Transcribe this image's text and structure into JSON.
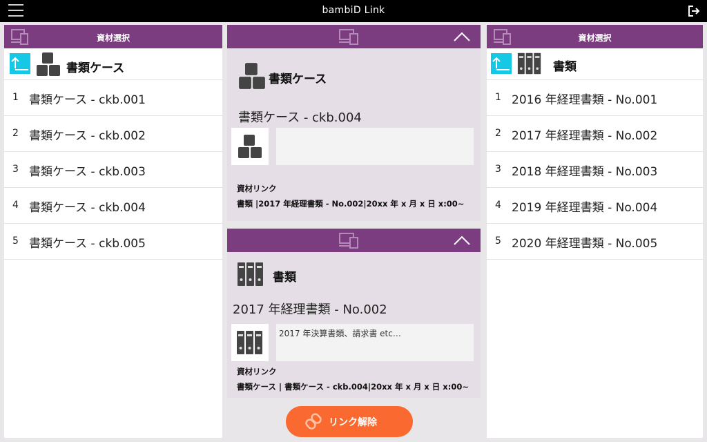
{
  "app": {
    "title": "bambiD Link"
  },
  "icons": {
    "menu": "hamburger-icon",
    "logout": "logout-icon",
    "device": "device-icon",
    "up": "up-level-icon",
    "case": "boxes-icon",
    "binders": "binders-icon",
    "chevron": "chevron-up-icon",
    "link": "link-icon"
  },
  "colors": {
    "header": "#7b3d80",
    "card_bg": "#e6dee6",
    "accent": "#14c8e6",
    "button": "#fa6a30"
  },
  "left": {
    "header": "資材選択",
    "crumb": "書類ケース",
    "items": [
      {
        "num": "1",
        "label": "書類ケース - ckb.001"
      },
      {
        "num": "2",
        "label": "書類ケース - ckb.002"
      },
      {
        "num": "3",
        "label": "書類ケース - ckb.003"
      },
      {
        "num": "4",
        "label": "書類ケース - ckb.004"
      },
      {
        "num": "5",
        "label": "書類ケース - ckb.005"
      }
    ]
  },
  "right": {
    "header": "資材選択",
    "crumb": "書類",
    "items": [
      {
        "num": "1",
        "label": "2016 年経理書類 - No.001"
      },
      {
        "num": "2",
        "label": "2017 年経理書類 - No.002"
      },
      {
        "num": "3",
        "label": "2018 年経理書類 - No.003"
      },
      {
        "num": "4",
        "label": "2019 年経理書類 - No.004"
      },
      {
        "num": "5",
        "label": "2020 年経理書類 - No.005"
      }
    ]
  },
  "cards": [
    {
      "kind": "書類ケース",
      "name": "書類ケース - ckb.004",
      "memo": "",
      "link_title": "資材リンク",
      "link_body": "書類 |2017 年経理書類 - No.002|20xx 年 x 月 x 日 x:00~"
    },
    {
      "kind": "書類",
      "name": "2017 年経理書類 - No.002",
      "memo": "2017 年決算書類、請求書 etc…",
      "link_title": "資材リンク",
      "link_body": "書類ケース | 書類ケース - ckb.004|20xx 年 x 月 x 日 x:00~"
    }
  ],
  "unlink": {
    "label": "リンク解除"
  }
}
